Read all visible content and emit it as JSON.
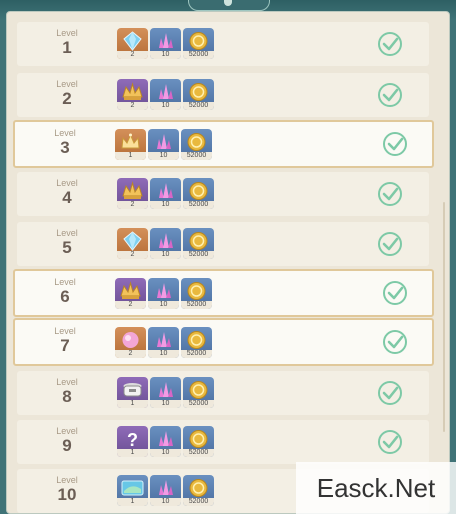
{
  "level_caption": "Level",
  "rows": [
    {
      "level": "1",
      "rewards": [
        {
          "item": "blue-gem",
          "count": "2"
        },
        {
          "item": "pink-crystal",
          "count": "10"
        },
        {
          "item": "mora-coin",
          "count": "52000"
        }
      ],
      "claimed": true,
      "highlight": false
    },
    {
      "level": "2",
      "rewards": [
        {
          "item": "gold-wing-crown",
          "count": "2"
        },
        {
          "item": "pink-crystal",
          "count": "10"
        },
        {
          "item": "mora-coin",
          "count": "52000"
        }
      ],
      "claimed": true,
      "highlight": false
    },
    {
      "level": "3",
      "rewards": [
        {
          "item": "crown",
          "count": "1"
        },
        {
          "item": "pink-crystal",
          "count": "10"
        },
        {
          "item": "mora-coin",
          "count": "52000"
        }
      ],
      "claimed": true,
      "highlight": true
    },
    {
      "level": "4",
      "rewards": [
        {
          "item": "gold-wing-crown",
          "count": "2"
        },
        {
          "item": "pink-crystal",
          "count": "10"
        },
        {
          "item": "mora-coin",
          "count": "52000"
        }
      ],
      "claimed": true,
      "highlight": false
    },
    {
      "level": "5",
      "rewards": [
        {
          "item": "blue-gem",
          "count": "2"
        },
        {
          "item": "pink-crystal",
          "count": "10"
        },
        {
          "item": "mora-coin",
          "count": "52000"
        }
      ],
      "claimed": true,
      "highlight": false
    },
    {
      "level": "6",
      "rewards": [
        {
          "item": "gold-wing-crown",
          "count": "2"
        },
        {
          "item": "pink-crystal",
          "count": "10"
        },
        {
          "item": "mora-coin",
          "count": "52000"
        }
      ],
      "claimed": true,
      "highlight": true
    },
    {
      "level": "7",
      "rewards": [
        {
          "item": "pink-gem",
          "count": "2"
        },
        {
          "item": "pink-crystal",
          "count": "10"
        },
        {
          "item": "mora-coin",
          "count": "52000"
        }
      ],
      "claimed": true,
      "highlight": true
    },
    {
      "level": "8",
      "rewards": [
        {
          "item": "cooking-pot",
          "count": "1"
        },
        {
          "item": "pink-crystal",
          "count": "10"
        },
        {
          "item": "mora-coin",
          "count": "52000"
        }
      ],
      "claimed": true,
      "highlight": false
    },
    {
      "level": "9",
      "rewards": [
        {
          "item": "mystery-item",
          "count": "1"
        },
        {
          "item": "pink-crystal",
          "count": "10"
        },
        {
          "item": "mora-coin",
          "count": "52000"
        }
      ],
      "claimed": true,
      "highlight": false
    },
    {
      "level": "10",
      "rewards": [
        {
          "item": "tablet-screen",
          "count": "1"
        },
        {
          "item": "pink-crystal",
          "count": "10"
        },
        {
          "item": "mora-coin",
          "count": "52000"
        }
      ],
      "claimed": false,
      "highlight": false
    }
  ],
  "colors": {
    "check": "#7dc9a6",
    "accent_border": "#e0c89a",
    "frame": "#3f7377"
  },
  "watermark": "Easck.Net"
}
